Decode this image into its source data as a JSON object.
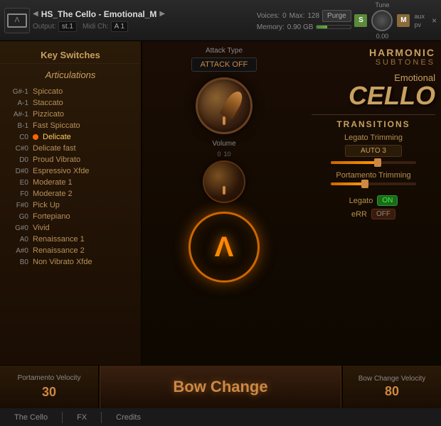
{
  "window": {
    "title": "HS_The Cello - Emotional_M",
    "close_btn": "×"
  },
  "topbar": {
    "logo": "Λ",
    "output_label": "Output:",
    "output_value": "st.1",
    "midi_label": "Midi Ch:",
    "midi_value": "A 1",
    "voices_label": "Voices:",
    "voices_value": "0",
    "max_label": "Max:",
    "max_value": "128",
    "purge_btn": "Purge",
    "memory_label": "Memory:",
    "memory_value": "0.90 GB",
    "tune_label": "Tune",
    "tune_value": "0.00",
    "s_btn": "S",
    "m_btn": "M",
    "aux_label": "aux",
    "pv_label": "pv",
    "progress_pct": 30
  },
  "left_panel": {
    "key_switches_header": "Key Switches",
    "articulations_header": "Articulations",
    "items": [
      {
        "key": "G#-1",
        "name": "Spiccato",
        "active": false
      },
      {
        "key": "A-1",
        "name": "Staccato",
        "active": false
      },
      {
        "key": "A#-1",
        "name": "Pizzicato",
        "active": false
      },
      {
        "key": "B-1",
        "name": "Fast Spiccato",
        "active": false
      },
      {
        "key": "C0",
        "name": "Delicate",
        "active": true
      },
      {
        "key": "C#0",
        "name": "Delicate fast",
        "active": false
      },
      {
        "key": "D0",
        "name": "Proud Vibrato",
        "active": false
      },
      {
        "key": "D#0",
        "name": "Espressivo Xfde",
        "active": false
      },
      {
        "key": "E0",
        "name": "Moderate 1",
        "active": false
      },
      {
        "key": "F0",
        "name": "Moderate 2",
        "active": false
      },
      {
        "key": "F#0",
        "name": "Pick Up",
        "active": false
      },
      {
        "key": "G0",
        "name": "Fortepiano",
        "active": false
      },
      {
        "key": "G#0",
        "name": "Vivid",
        "active": false
      },
      {
        "key": "A0",
        "name": "Renaissance 1",
        "active": false
      },
      {
        "key": "A#0",
        "name": "Renaissance 2",
        "active": false
      },
      {
        "key": "B0",
        "name": "Non Vibrato Xfde",
        "active": false
      }
    ]
  },
  "center_panel": {
    "attack_type_label": "Attack Type",
    "attack_off_label": "ATTACK OFF",
    "volume_label": "Volume",
    "volume_scale_min": "0",
    "volume_scale_max": "10"
  },
  "right_panel": {
    "harmonic_label": "HARMONIC",
    "subtones_label": "SUBTONES",
    "emotional_label": "Emotional",
    "cello_label": "CELLO",
    "transitions_label": "TRANSITIONS",
    "legato_trimming_label": "Legato Trimming",
    "auto_dropdown": "AUTO 3",
    "portamento_trimming_label": "Portamento Trimming",
    "legato_label": "Legato",
    "legato_toggle": "ON",
    "err_label": "eRR",
    "err_toggle": "OFF"
  },
  "bottom_bar": {
    "portamento_velocity_label": "Portamento Velocity",
    "portamento_velocity_value": "30",
    "bow_change_label": "Bow Change",
    "bow_change_velocity_label": "Bow Change Velocity",
    "bow_change_velocity_value": "80"
  },
  "footer": {
    "the_cello": "The Cello",
    "fx": "FX",
    "credits": "Credits"
  }
}
